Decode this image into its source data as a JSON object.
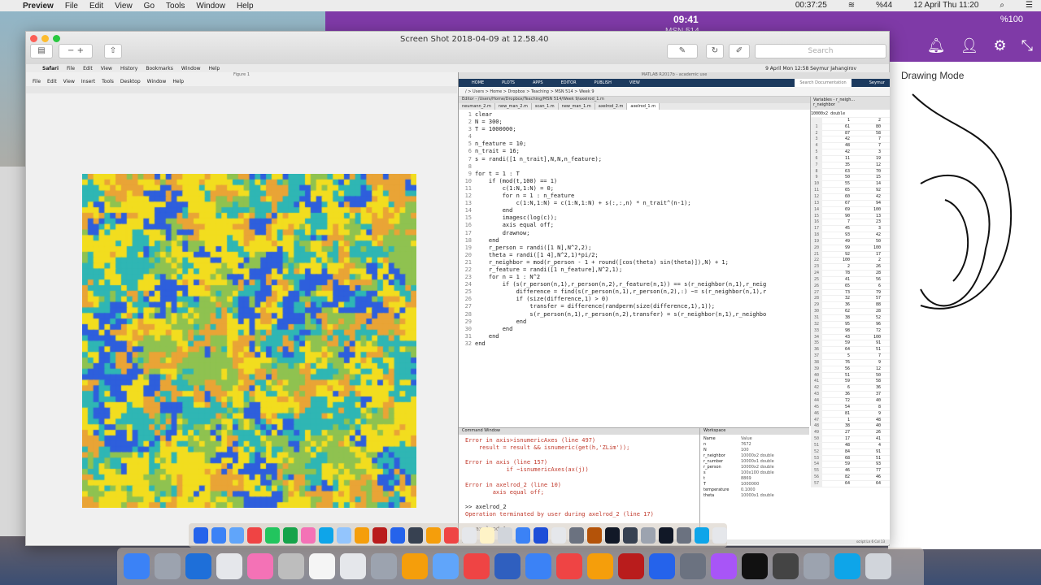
{
  "menubar": {
    "app_name": "Preview",
    "menus": [
      "File",
      "Edit",
      "View",
      "Go",
      "Tools",
      "Window",
      "Help"
    ],
    "time": "00:37:25",
    "battery": "%44",
    "date": "12 April Thu  11:20"
  },
  "ipad": {
    "clock": "09:41",
    "subtitle": "MSN 514",
    "battery": "%100",
    "drawing_mode": "Drawing Mode"
  },
  "preview": {
    "title": "Screen Shot 2018-04-09 at 12.58.40",
    "search_placeholder": "Search"
  },
  "inner_menubar": [
    "Safari",
    "File",
    "Edit",
    "View",
    "History",
    "Bookmarks",
    "Window",
    "Help"
  ],
  "inner_clock": "9 April Mon  12:58  Seymur Jahangirov",
  "figure": {
    "title": "Figure 1",
    "menu": [
      "File",
      "Edit",
      "View",
      "Insert",
      "Tools",
      "Desktop",
      "Window",
      "Help"
    ]
  },
  "matlab": {
    "title": "MATLAB R2017b - academic use",
    "tabs": [
      "HOME",
      "PLOTS",
      "APPS",
      "EDITOR",
      "PUBLISH",
      "VIEW"
    ],
    "path": "/ > Users > Home > Dropbox > Teaching > MSN 514 > Week 9",
    "search_placeholder": "Search Documentation",
    "user": "Seymur",
    "editor_header": "Editor - /Users/Home/Dropbox/Teaching/MSN 514/Week 9/axelrod_1.m",
    "editor_tabs": [
      "neumann_2.m",
      "new_man_2.m",
      "scan_1.m",
      "new_man_1.m",
      "axelrod_2.m",
      "axelrod_1.m"
    ],
    "active_tab": "axelrod_1.m",
    "code": [
      "clear",
      "N = 300;",
      "T = 1000000;",
      "",
      "n_feature = 10;",
      "n_trait = 16;",
      "s = randi([1 n_trait],N,N,n_feature);",
      "",
      "for t = 1 : T",
      "    if (mod(t,100) == 1)",
      "        c(1:N,1:N) = 0;",
      "        for n = 1 : n_feature",
      "            c(1:N,1:N) = c(1:N,1:N) + s(:,:,n) * n_trait^(n-1);",
      "        end",
      "        imagesc(log(c));",
      "        axis equal off;",
      "        drawnow;",
      "    end",
      "    r_person = randi([1 N],N^2,2);",
      "    theta = randi([1 4],N^2,1)*pi/2;",
      "    r_neighbor = mod(r_person - 1 + round([cos(theta) sin(theta)]),N) + 1;",
      "    r_feature = randi([1 n_feature],N^2,1);",
      "    for n = 1 : N^2",
      "        if (s(r_person(n,1),r_person(n,2),r_feature(n,1)) == s(r_neighbor(n,1),r_neig",
      "            difference = find(s(r_person(n,1),r_person(n,2),:) ~= s(r_neighbor(n,1),r",
      "            if (size(difference,1) > 0)",
      "                transfer = difference(randperm(size(difference,1),1));",
      "                s(r_person(n,1),r_person(n,2),transfer) = s(r_neighbor(n,1),r_neighbo",
      "            end",
      "        end",
      "    end",
      "end"
    ],
    "variables": {
      "title": "Variables - r_neigh...",
      "var_tab": "r_neighbor",
      "size": "10000x2 double",
      "col_headers": [
        "1",
        "2"
      ],
      "rows": [
        [
          "61",
          "80"
        ],
        [
          "87",
          "58"
        ],
        [
          "42",
          "7"
        ],
        [
          "48",
          "7"
        ],
        [
          "42",
          "3"
        ],
        [
          "11",
          "19"
        ],
        [
          "35",
          "12"
        ],
        [
          "63",
          "70"
        ],
        [
          "50",
          "15"
        ],
        [
          "55",
          "14"
        ],
        [
          "65",
          "92"
        ],
        [
          "60",
          "42"
        ],
        [
          "67",
          "94"
        ],
        [
          "69",
          "100"
        ],
        [
          "90",
          "13"
        ],
        [
          "7",
          "23"
        ],
        [
          "45",
          "3"
        ],
        [
          "93",
          "42"
        ],
        [
          "49",
          "50"
        ],
        [
          "99",
          "100"
        ],
        [
          "92",
          "17"
        ],
        [
          "100",
          "2"
        ],
        [
          "2",
          "26"
        ],
        [
          "78",
          "28"
        ],
        [
          "41",
          "56"
        ],
        [
          "65",
          "6"
        ],
        [
          "73",
          "79"
        ],
        [
          "32",
          "57"
        ],
        [
          "36",
          "88"
        ],
        [
          "62",
          "28"
        ],
        [
          "38",
          "52"
        ],
        [
          "95",
          "96"
        ],
        [
          "98",
          "72"
        ],
        [
          "43",
          "100"
        ],
        [
          "59",
          "91"
        ],
        [
          "64",
          "51"
        ],
        [
          "5",
          "7"
        ],
        [
          "76",
          "9"
        ],
        [
          "56",
          "12"
        ],
        [
          "51",
          "50"
        ],
        [
          "59",
          "58"
        ],
        [
          "6",
          "36"
        ],
        [
          "36",
          "37"
        ],
        [
          "72",
          "40"
        ],
        [
          "54",
          "8"
        ],
        [
          "81",
          "9"
        ],
        [
          "1",
          "48"
        ],
        [
          "38",
          "40"
        ],
        [
          "27",
          "26"
        ],
        [
          "17",
          "41"
        ],
        [
          "48",
          "4"
        ],
        [
          "84",
          "91"
        ],
        [
          "68",
          "51"
        ],
        [
          "59",
          "93"
        ],
        [
          "46",
          "77"
        ],
        [
          "82",
          "46"
        ],
        [
          "64",
          "64"
        ]
      ]
    },
    "command_window": {
      "title": "Command Window",
      "lines": [
        {
          "type": "err",
          "text": "Error in axis>isnumericAxes (line 497)"
        },
        {
          "type": "err",
          "text": "    result = result && isnumeric(get(h,'ZLim'));"
        },
        {
          "type": "blank",
          "text": ""
        },
        {
          "type": "err",
          "text": "Error in axis (line 157)"
        },
        {
          "type": "err",
          "text": "            if ~isnumericAxes(ax(j))"
        },
        {
          "type": "blank",
          "text": ""
        },
        {
          "type": "err",
          "text": "Error in axelrod_2 (line 10)"
        },
        {
          "type": "err",
          "text": "        axis equal off;"
        },
        {
          "type": "blank",
          "text": ""
        },
        {
          "type": "cmd",
          "text": ">> axelrod_2"
        },
        {
          "type": "err",
          "text": "Operation terminated by user during axelrod_2 (line 17)"
        },
        {
          "type": "blank",
          "text": ""
        },
        {
          "type": "cmd",
          "text": ">> axelrod_1"
        }
      ],
      "prompt": "fx"
    },
    "workspace": {
      "title": "Workspace",
      "headers": [
        "Name",
        "Value"
      ],
      "rows": [
        [
          "n",
          "7672"
        ],
        [
          "N",
          "100"
        ],
        [
          "r_neighbor",
          "10000x2 double"
        ],
        [
          "r_number",
          "10000x1 double"
        ],
        [
          "r_person",
          "10000x2 double"
        ],
        [
          "s",
          "100x100 double"
        ],
        [
          "t",
          "8869"
        ],
        [
          "T",
          "1000000"
        ],
        [
          "temperature",
          "0.1000"
        ],
        [
          "theta",
          "10000x1 double"
        ]
      ]
    },
    "status": "Busy",
    "status_right": "script    Ln 6   Col 13"
  },
  "colors": {
    "purple": "#7f3aa7",
    "matlab_blue": "#1c3a5e",
    "error_red": "#c0392b",
    "heat_yellow": "#f2dd1f",
    "heat_orange": "#e9a436",
    "heat_green": "#8fc250",
    "heat_teal": "#2fb6b4",
    "heat_blue": "#2e5fdc"
  }
}
